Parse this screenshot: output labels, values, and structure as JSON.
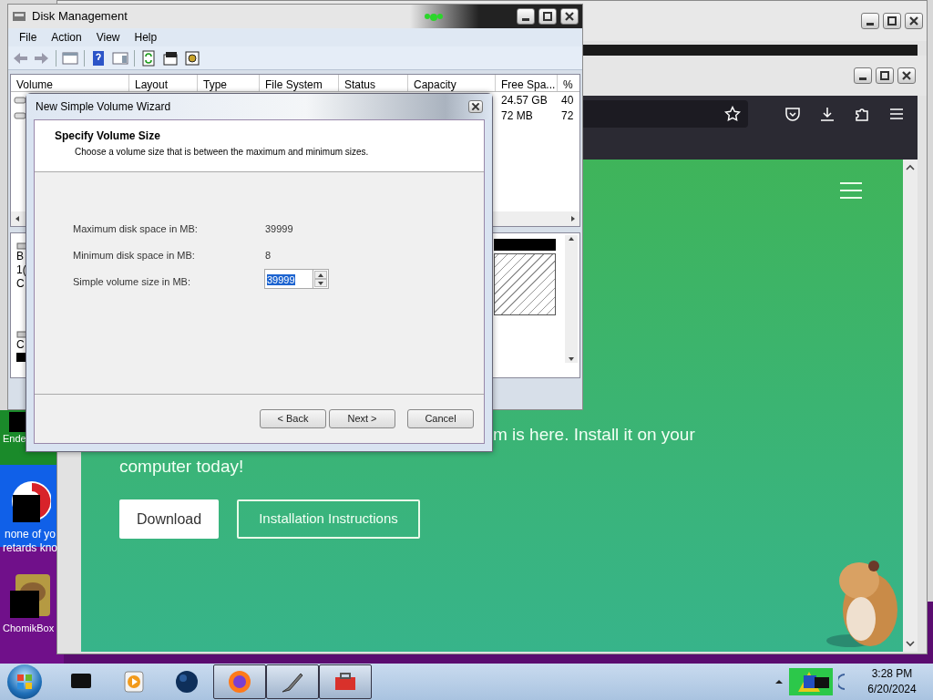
{
  "disk_management": {
    "title": "Disk Management",
    "menu": [
      "File",
      "Action",
      "View",
      "Help"
    ],
    "columns": [
      "Volume",
      "Layout",
      "Type",
      "File System",
      "Status",
      "Capacity",
      "Free Spa...",
      "%"
    ],
    "rows": [
      {
        "free_space": "24.57 GB",
        "percent": "40"
      },
      {
        "free_space": "72 MB",
        "percent": "72"
      }
    ],
    "disk_labels": [
      "B",
      "1(",
      "C"
    ],
    "disk_label_2": "C"
  },
  "wizard": {
    "title": "New Simple Volume Wizard",
    "heading": "Specify Volume Size",
    "subtitle": "Choose a volume size that is between the maximum and minimum sizes.",
    "fields": [
      {
        "label": "Maximum disk space in MB:",
        "value": "39999"
      },
      {
        "label": "Minimum disk space in MB:",
        "value": "8"
      }
    ],
    "size_input": {
      "label": "Simple volume size in MB:",
      "value": "39999"
    },
    "buttons": [
      "< Back",
      "Next >",
      "Cancel"
    ]
  },
  "browser": {
    "hero_line_1": "m is here. Install it on your",
    "hero_line_2": "computer today!",
    "buttons": [
      "Download",
      "Installation Instructions"
    ]
  },
  "desktop_icons": [
    {
      "label": "Ende",
      "color": "#1a8a2a"
    },
    {
      "label": "none of yo retards kno",
      "color": "#1060e8"
    },
    {
      "label": "ChomikBox",
      "color": "#70108a"
    }
  ],
  "taskbar": {
    "time": "3:28 PM",
    "date": "6/20/2024"
  }
}
